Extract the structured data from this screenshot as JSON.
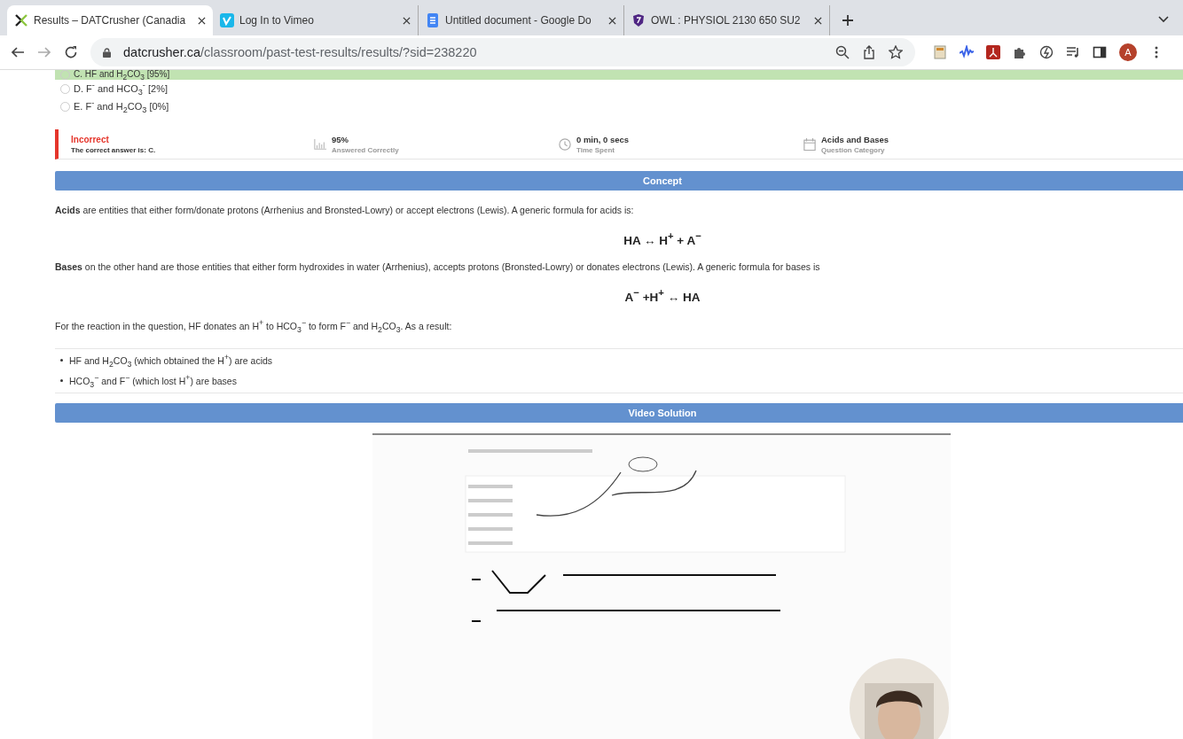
{
  "browser": {
    "tabs": [
      {
        "title": "Results – DATCrusher (Canadia",
        "selected": true
      },
      {
        "title": "Log In to Vimeo",
        "selected": false
      },
      {
        "title": "Untitled document - Google Do",
        "selected": false
      },
      {
        "title": "OWL : PHYSIOL 2130 650 SU2",
        "selected": false
      }
    ],
    "url": {
      "domain": "datcrusher.ca",
      "path": "/classroom/past-test-results/results/?sid=238220"
    },
    "avatar": "A"
  },
  "answers": [
    {
      "label": "C. HF and H$_{2}$CO$_{3}$ [95%]",
      "correct": true
    },
    {
      "label": "D. F$^{-}$ and HCO$_{3}$$^{-}$ [2%]",
      "correct": false
    },
    {
      "label": "E. F$^{-}$ and H$_{2}$CO$_{3}$ [0%]",
      "correct": false
    }
  ],
  "result": {
    "status": "Incorrect",
    "note": "The correct answer is: C.",
    "stats": [
      {
        "value": "95%",
        "label": "Answered Correctly"
      },
      {
        "value": "0 min, 0 secs",
        "label": "Time Spent"
      },
      {
        "value": "Acids and Bases",
        "label": "Question Category"
      }
    ]
  },
  "concept": {
    "title": "Concept",
    "blocks": [
      {
        "kind": "paragraph",
        "text": "**Acids** are entities that either form/donate protons (Arrhenius and Bronsted-Lowry) or accept electrons (Lewis). A generic formula for acids is:"
      },
      {
        "kind": "formula",
        "text": "HA ↔ H$^{+}$ + A$^{−}$"
      },
      {
        "kind": "paragraph",
        "text": "**Bases** on the other hand are those entities that either form hydroxides in water (Arrhenius), accepts protons (Bronsted-Lowry) or donates electrons (Lewis). A generic formula for bases is"
      },
      {
        "kind": "formula",
        "text": "A$^{−}$ +H$^{+}$ ↔ HA"
      },
      {
        "kind": "paragraph",
        "text": "For the reaction in the question, HF donates an H$^{+}$ to HCO$_{3}$$^{−}$  to form F$^{−}$ and H$_{2}$CO$_{3}$. As a result:"
      },
      {
        "kind": "list",
        "items": [
          "HF and H$_{2}$CO$_{3}$ (which obtained the H$^{+}$) are acids",
          "HCO$_{3}$$^{−}$ and F$^{−}$ (which lost H$^{+}$) are bases"
        ]
      }
    ]
  },
  "video": {
    "title": "Video Solution",
    "kind": "picture"
  }
}
